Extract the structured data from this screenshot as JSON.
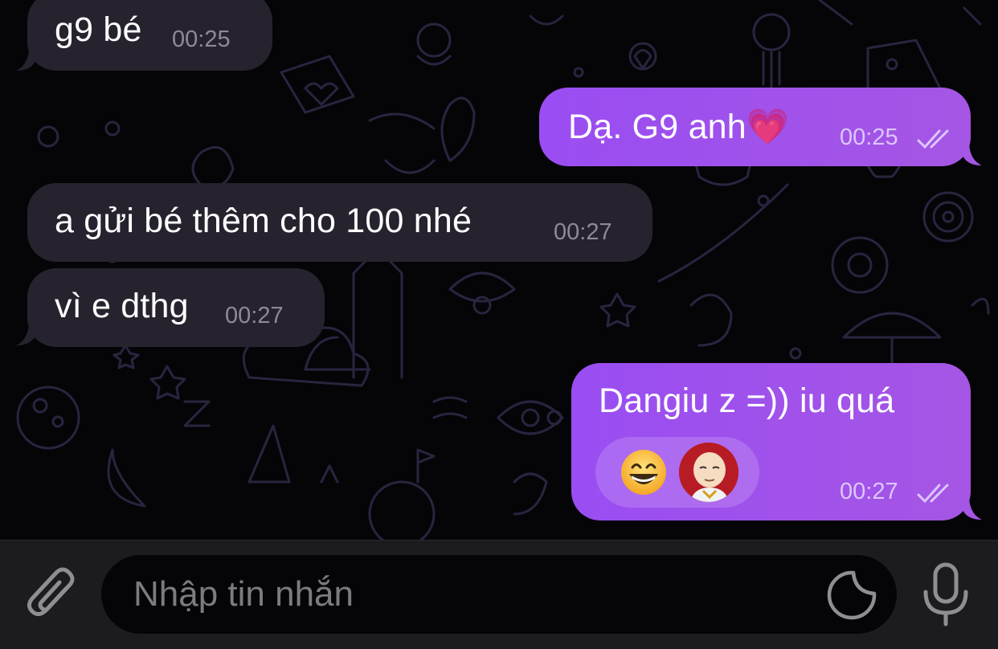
{
  "messages": [
    {
      "direction": "incoming",
      "text": "g9 bé",
      "time": "00:25"
    },
    {
      "direction": "outgoing",
      "text": "Dạ. G9 anh💗",
      "time": "00:25",
      "status": "read"
    },
    {
      "direction": "incoming",
      "text": "a gửi bé thêm cho 100 nhé",
      "time": "00:27"
    },
    {
      "direction": "incoming",
      "text": "vì e dthg",
      "time": "00:27"
    },
    {
      "direction": "outgoing",
      "text": "Dangiu z =)) iu quá",
      "time": "00:27",
      "status": "read",
      "reactions": [
        "grinning-face-with-smiling-eyes",
        "user-avatar"
      ]
    }
  ],
  "composer": {
    "placeholder": "Nhập tin nhắn",
    "attach_icon": "paperclip-icon",
    "sticker_icon": "sticker-icon",
    "mic_icon": "microphone-icon"
  },
  "colors": {
    "incoming_bubble": "#27232e",
    "outgoing_bubble": "#9a4df2",
    "background": "#050507",
    "input_bar": "#1c1c1e"
  }
}
